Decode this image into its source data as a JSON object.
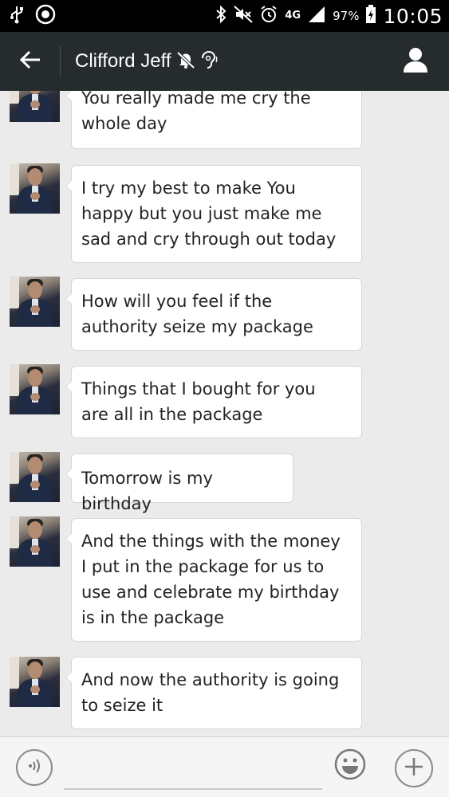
{
  "status_bar": {
    "network": "4G",
    "battery_percent": "97%",
    "time": "10:05",
    "left_icons": [
      "usb-icon",
      "ring-icon"
    ],
    "right_icons": [
      "bluetooth-icon",
      "mute-icon",
      "alarm-icon",
      "network-icon",
      "signal-icon",
      "battery-icon"
    ]
  },
  "header": {
    "title": "Clifford Jeff",
    "background": "#262b2e",
    "icons": [
      "back-arrow-icon",
      "muted-bell-icon",
      "speaker-icon",
      "person-icon"
    ]
  },
  "messages": [
    {
      "text": "You really made me cry the\nwhole day"
    },
    {
      "text": "I try my best to make You\nhappy but you just make me\nsad and cry through out today"
    },
    {
      "text": "How will you feel if the\nauthority seize my package"
    },
    {
      "text": "Things that I bought for you\nare all in the package"
    },
    {
      "text": "Tomorrow is my birthday"
    },
    {
      "text": "And the things with the money\nI put in the package for us to\nuse and celebrate my birthday\nis in the package"
    },
    {
      "text": "And now the authority is going\nto seize it"
    }
  ],
  "input_bar": {
    "placeholder": "",
    "icons": [
      "voice-icon",
      "emoji-icon",
      "plus-icon"
    ]
  },
  "colors": {
    "chat_background": "#ebebeb",
    "bubble_background": "#ffffff",
    "bubble_border": "#d6d6d6"
  }
}
